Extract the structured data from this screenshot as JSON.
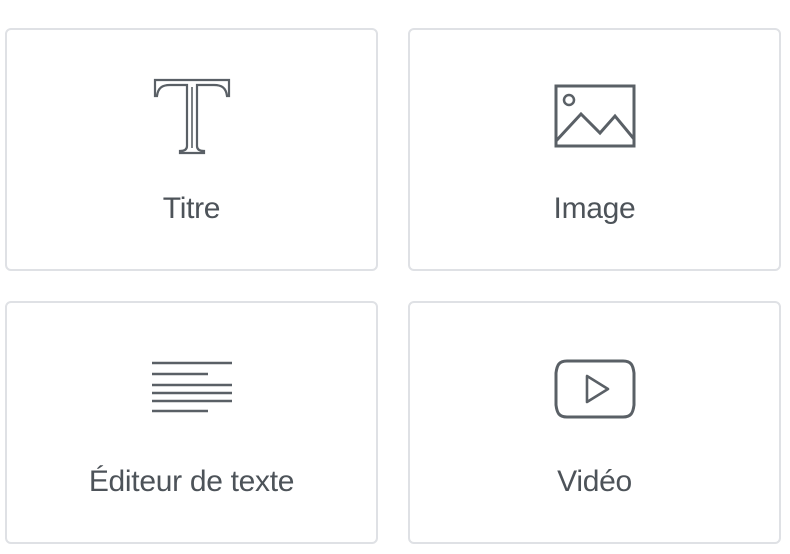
{
  "colors": {
    "card_border": "#dfe1e5",
    "icon_stroke": "#5a6066",
    "label_text": "#4d5359"
  },
  "widgets": [
    {
      "label": "Titre",
      "icon": "heading-t-icon"
    },
    {
      "label": "Image",
      "icon": "image-icon"
    },
    {
      "label": "Éditeur de texte",
      "icon": "text-editor-icon"
    },
    {
      "label": "Vidéo",
      "icon": "video-play-icon"
    }
  ]
}
